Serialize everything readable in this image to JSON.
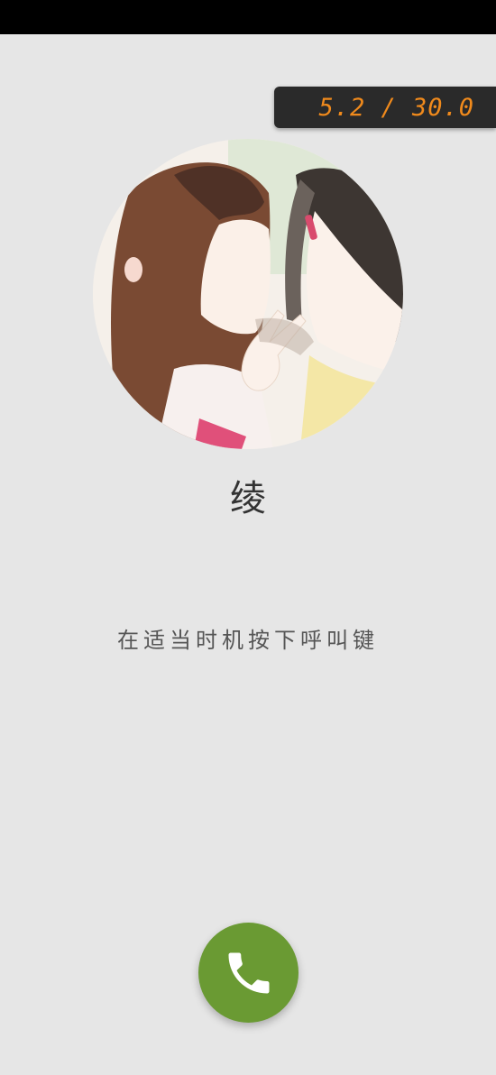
{
  "timer": {
    "elapsed": "5.2",
    "total": "30.0",
    "display": "5.2 / 30.0",
    "color": "#f08a1c"
  },
  "caller": {
    "name": "绫",
    "avatar_icon": "watercolor-two-girls-portrait"
  },
  "hint": "在适当时机按下呼叫键",
  "call_button": {
    "icon": "phone-icon",
    "color": "#6a9a33"
  }
}
